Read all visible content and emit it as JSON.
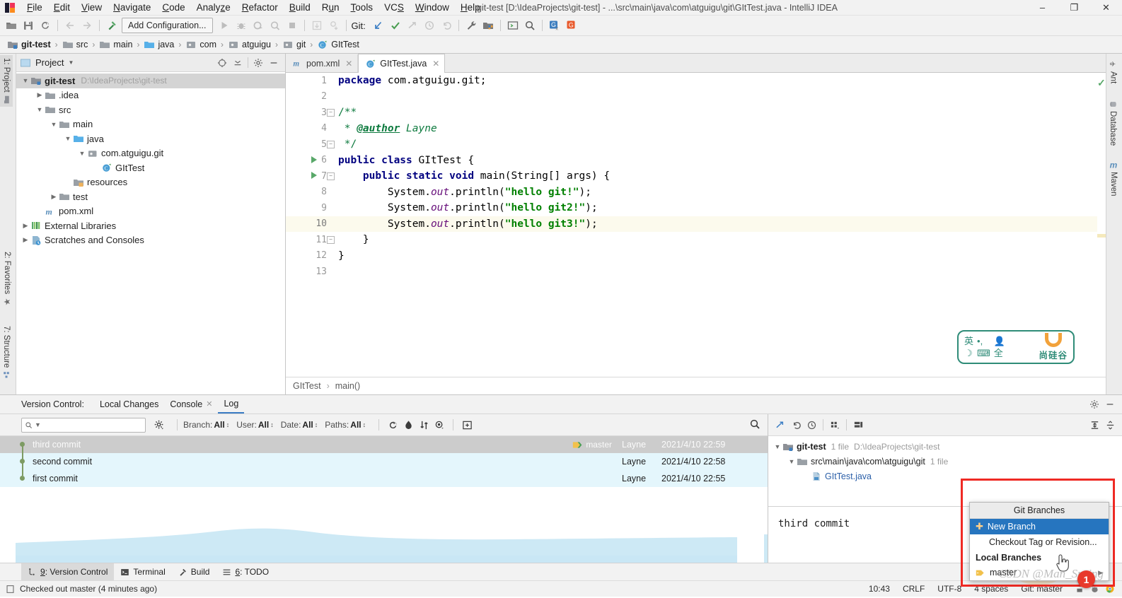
{
  "titlebar": {
    "menus": [
      "File",
      "Edit",
      "View",
      "Navigate",
      "Code",
      "Analyze",
      "Refactor",
      "Build",
      "Run",
      "Tools",
      "VCS",
      "Window",
      "Help"
    ],
    "window_title": "git-test [D:\\IdeaProjects\\git-test] - ...\\src\\main\\java\\com\\atguigu\\git\\GItTest.java - IntelliJ IDEA",
    "minimize": "–",
    "maximize": "❐",
    "close": "✕"
  },
  "toolbar": {
    "run_configuration": "Add Configuration...",
    "git_label": "Git:"
  },
  "breadcrumb": {
    "items": [
      "git-test",
      "src",
      "main",
      "java",
      "com",
      "atguigu",
      "git",
      "GItTest"
    ],
    "separator": "›"
  },
  "left_strip": {
    "project_tab": "1: Project",
    "favorites_tab": "2: Favorites",
    "structure_tab": "7: Structure"
  },
  "right_strip": {
    "ant_tab": "Ant",
    "database_tab": "Database",
    "maven_tab": "Maven"
  },
  "project": {
    "title": "Project",
    "tree": [
      {
        "label": "git-test",
        "path": "D:\\IdeaProjects\\git-test",
        "indent": 0,
        "arrow": "down",
        "icon": "module",
        "bold": true,
        "selected": true
      },
      {
        "label": ".idea",
        "path": "",
        "indent": 1,
        "arrow": "right",
        "icon": "folder-gray",
        "bold": false,
        "selected": false
      },
      {
        "label": "src",
        "path": "",
        "indent": 1,
        "arrow": "down",
        "icon": "folder-gray",
        "bold": false,
        "selected": false
      },
      {
        "label": "main",
        "path": "",
        "indent": 2,
        "arrow": "down",
        "icon": "folder-gray",
        "bold": false,
        "selected": false
      },
      {
        "label": "java",
        "path": "",
        "indent": 3,
        "arrow": "down",
        "icon": "folder-blue",
        "bold": false,
        "selected": false
      },
      {
        "label": "com.atguigu.git",
        "path": "",
        "indent": 4,
        "arrow": "down",
        "icon": "package",
        "bold": false,
        "selected": false
      },
      {
        "label": "GItTest",
        "path": "",
        "indent": 5,
        "arrow": "none",
        "icon": "class",
        "bold": false,
        "selected": false
      },
      {
        "label": "resources",
        "path": "",
        "indent": 3,
        "arrow": "none",
        "icon": "folder-res",
        "bold": false,
        "selected": false
      },
      {
        "label": "test",
        "path": "",
        "indent": 2,
        "arrow": "right",
        "icon": "folder-gray",
        "bold": false,
        "selected": false
      },
      {
        "label": "pom.xml",
        "path": "",
        "indent": 1,
        "arrow": "none",
        "icon": "maven",
        "bold": false,
        "selected": false
      },
      {
        "label": "External Libraries",
        "path": "",
        "indent": 0,
        "arrow": "right",
        "icon": "libs",
        "bold": false,
        "selected": false
      },
      {
        "label": "Scratches and Consoles",
        "path": "",
        "indent": 0,
        "arrow": "right",
        "icon": "scratch",
        "bold": false,
        "selected": false
      }
    ]
  },
  "editor": {
    "tabs": [
      {
        "label": "pom.xml",
        "icon": "maven-icon",
        "active": false
      },
      {
        "label": "GItTest.java",
        "icon": "java-class-icon",
        "active": true
      }
    ],
    "line_numbers": [
      "1",
      "2",
      "3",
      "4",
      "5",
      "6",
      "7",
      "8",
      "9",
      "10",
      "11",
      "12",
      "13"
    ],
    "highlighted_line": 10,
    "code_lines": [
      {
        "n": 1,
        "html": "<span class=\"kw\">package</span> <span class=\"pl\">com.atguigu.git;</span>"
      },
      {
        "n": 2,
        "html": ""
      },
      {
        "n": 3,
        "html": "<span class=\"doc\">/**</span>"
      },
      {
        "n": 4,
        "html": "<span class=\"doc\"> * </span><span class=\"tag\">@author</span><span class=\"doc\"> <i>Layne</i></span>"
      },
      {
        "n": 5,
        "html": "<span class=\"doc\"> */</span>"
      },
      {
        "n": 6,
        "html": "<span class=\"kw\">public class</span> <span class=\"pl\">GItTest {</span>"
      },
      {
        "n": 7,
        "html": "    <span class=\"kw\">public static void</span> <span class=\"pl\">main(String[] args) {</span>"
      },
      {
        "n": 8,
        "html": "        <span class=\"pl\">System.</span><span class=\"it\">out</span><span class=\"pl\">.println(</span><span class=\"str\">\"hello git!\"</span><span class=\"pl\">);</span>"
      },
      {
        "n": 9,
        "html": "        <span class=\"pl\">System.</span><span class=\"it\">out</span><span class=\"pl\">.println(</span><span class=\"str\">\"hello git2!\"</span><span class=\"pl\">);</span>"
      },
      {
        "n": 10,
        "html": "        <span class=\"pl\">System.</span><span class=\"it\">out</span><span class=\"pl\">.println(</span><span class=\"str\">\"hello git3!\"</span><span class=\"pl\">);</span>"
      },
      {
        "n": 11,
        "html": "    <span class=\"pl\">}</span>"
      },
      {
        "n": 12,
        "html": "<span class=\"pl\">}</span>"
      },
      {
        "n": 13,
        "html": ""
      }
    ],
    "crumb_class": "GItTest",
    "crumb_method": "main()",
    "crumb_sep": "›"
  },
  "ime": {
    "g1": "英",
    "g2": "•,",
    "g3": "👤",
    "g4": "☽",
    "g5": "⌨",
    "g6": "全",
    "brand": "尚硅谷"
  },
  "version_control": {
    "label": "Version Control:",
    "tabs": [
      {
        "label": "Local Changes",
        "closeable": false,
        "active": false
      },
      {
        "label": "Console",
        "closeable": true,
        "active": false
      },
      {
        "label": "Log",
        "closeable": false,
        "active": true
      }
    ],
    "filters": {
      "search_placeholder": "",
      "branch": {
        "name": "Branch:",
        "value": "All"
      },
      "user": {
        "name": "User:",
        "value": "All"
      },
      "date": {
        "name": "Date:",
        "value": "All"
      },
      "paths": {
        "name": "Paths:",
        "value": "All"
      }
    },
    "commits": [
      {
        "message": "third commit",
        "branch": "master",
        "author": "Layne",
        "date": "2021/4/10 22:59",
        "selected": true
      },
      {
        "message": "second commit",
        "branch": "",
        "author": "Layne",
        "date": "2021/4/10 22:58",
        "selected": false
      },
      {
        "message": "first commit",
        "branch": "",
        "author": "Layne",
        "date": "2021/4/10 22:55",
        "selected": false
      }
    ],
    "changes": [
      {
        "label": "git-test",
        "count": "1 file",
        "path": "D:\\IdeaProjects\\git-test",
        "indent": 0,
        "arrow": "down",
        "icon": "module"
      },
      {
        "label": "src\\main\\java\\com\\atguigu\\git",
        "count": "1 file",
        "path": "",
        "indent": 1,
        "arrow": "down",
        "icon": "folder-gray"
      },
      {
        "label": "GItTest.java",
        "count": "",
        "path": "",
        "indent": 2,
        "arrow": "none",
        "icon": "java-file"
      }
    ],
    "detail_message": "third commit"
  },
  "branches_popup": {
    "title": "Git Branches",
    "new_branch": "New Branch",
    "checkout": "Checkout Tag or Revision...",
    "local_branches_header": "Local Branches",
    "master": "master",
    "chevron": "▶",
    "badge": "1",
    "highlight_color": "#2675bf",
    "frame_color": "#ef2a24"
  },
  "watermark": "CSDN @Man_Spring",
  "tool_window_bar": {
    "items": [
      {
        "label": "9: Version Control",
        "icon": "vcs-icon",
        "selected": true
      },
      {
        "label": "Terminal",
        "icon": "terminal-icon",
        "selected": false
      },
      {
        "label": "Build",
        "icon": "build-icon",
        "selected": false
      },
      {
        "label": "6: TODO",
        "icon": "todo-icon",
        "selected": false
      }
    ]
  },
  "status_bar": {
    "message": "Checked out master (4 minutes ago)",
    "position": "10:43",
    "line_separator": "CRLF",
    "encoding": "UTF-8",
    "indent": "4 spaces",
    "git_branch": "Git: master"
  }
}
